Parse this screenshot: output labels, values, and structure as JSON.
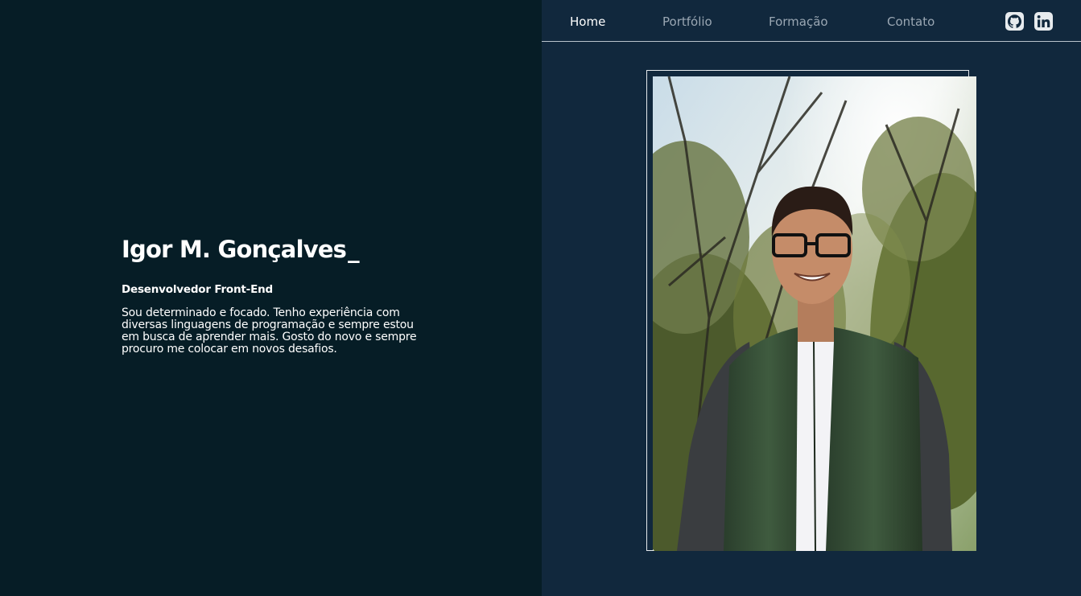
{
  "profile": {
    "name": "Igor M. Gonçalves",
    "cursor": "_",
    "role": "Desenvolvedor Front-End",
    "description": "Sou determinado e focado. Tenho experiência com diversas linguagens de programação e sempre estou em busca de aprender mais. Gosto do novo e sempre procuro me colocar em novos desafios."
  },
  "nav": {
    "items": [
      {
        "label": "Home",
        "active": true
      },
      {
        "label": "Portfólio",
        "active": false
      },
      {
        "label": "Formação",
        "active": false
      },
      {
        "label": "Contato",
        "active": false
      }
    ],
    "social": [
      {
        "icon": "github-icon"
      },
      {
        "icon": "linkedin-icon"
      }
    ]
  },
  "colors": {
    "left_bg": "#061d26",
    "right_bg": "#11283d",
    "text": "#ffffff",
    "nav_inactive": "#9aa7b3"
  },
  "photo": {
    "icon": "portrait-photo"
  }
}
